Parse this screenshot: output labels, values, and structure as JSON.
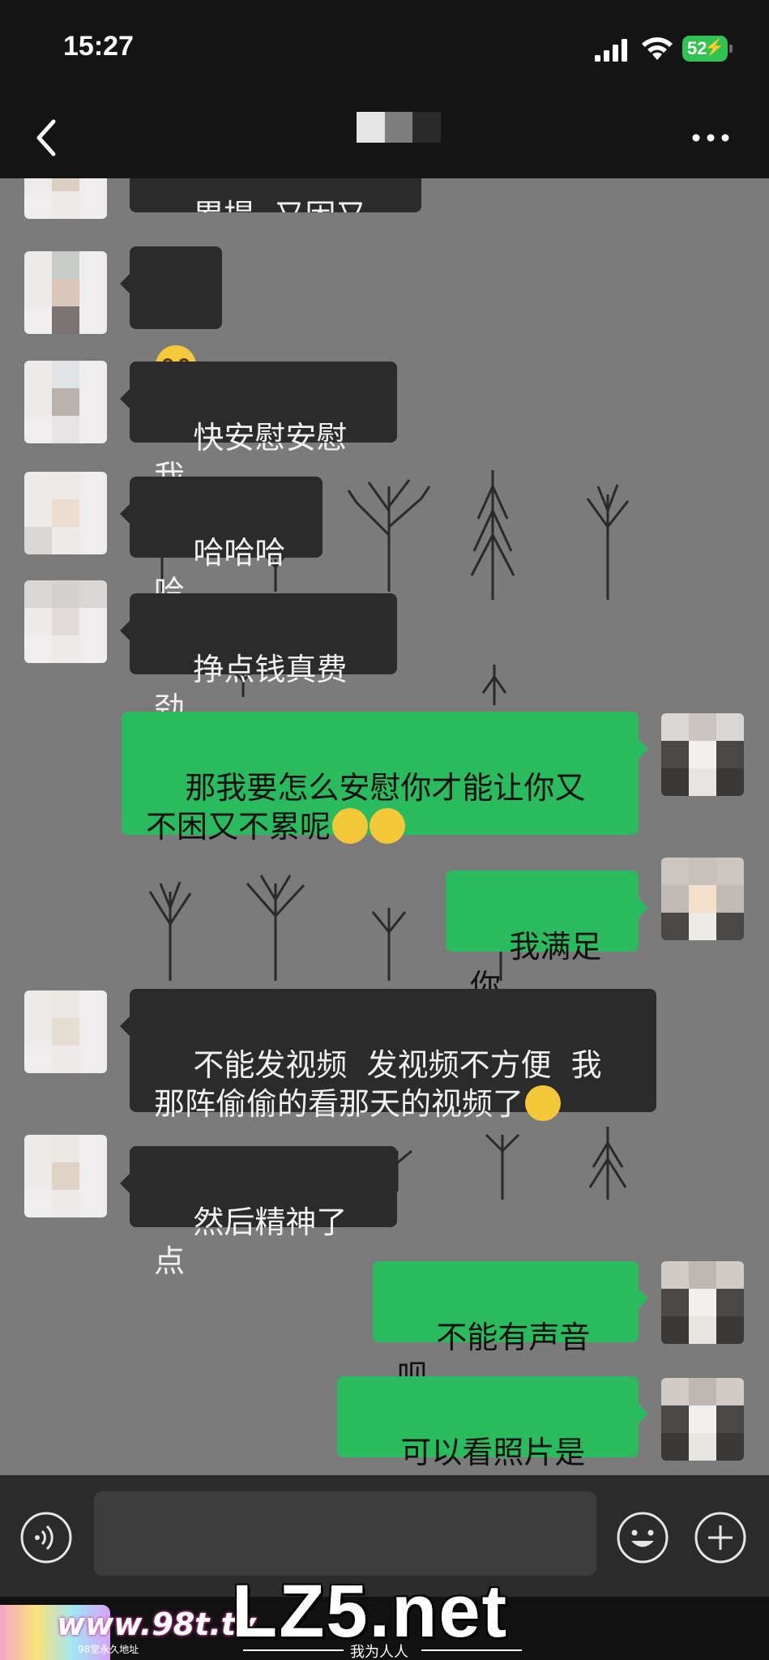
{
  "status_bar": {
    "time": "15:27",
    "battery_level": "52",
    "battery_charging": true,
    "signal_icon": "cellular-signal-icon",
    "wifi_icon": "wifi-icon"
  },
  "nav": {
    "back_icon": "chevron-left-icon",
    "more_icon": "more-dots-icon",
    "contact_name_blurred": true
  },
  "messages": [
    {
      "side": "in",
      "text": "累提  又困又累",
      "partial": true
    },
    {
      "side": "in",
      "text": "",
      "emoji": "loudly-crying-face"
    },
    {
      "side": "in",
      "text": "快安慰安慰我"
    },
    {
      "side": "in",
      "text": "哈哈哈哈"
    },
    {
      "side": "in",
      "text": "挣点钱真费劲"
    },
    {
      "side": "out",
      "text": "那我要怎么安慰你才能让你又不困又不累呢",
      "emoji": "thinking-face x2"
    },
    {
      "side": "out",
      "text": "我满足你"
    },
    {
      "side": "in",
      "text": "不能发视频  发视频不方便  我那阵偷偷的看那天的视频了",
      "emoji": "grinning-squinting-face"
    },
    {
      "side": "in",
      "text": "然后精神了点"
    },
    {
      "side": "out",
      "text": "不能有声音呗"
    },
    {
      "side": "out",
      "text": "可以看照片是吗"
    }
  ],
  "input_bar": {
    "voice_icon": "voice-input-icon",
    "emoji_icon": "emoji-icon",
    "plus_icon": "plus-circle-icon",
    "value": ""
  },
  "watermark": {
    "left": "www.98t.tv",
    "left_sub": "98堂永久地址",
    "logo": "LZ5.net",
    "sub": "我为人人"
  },
  "colors": {
    "chat_background": "#7b7b7b",
    "incoming_bubble": "#2b2b2b",
    "outgoing_bubble": "#2bbb5f",
    "header": "#141414"
  }
}
